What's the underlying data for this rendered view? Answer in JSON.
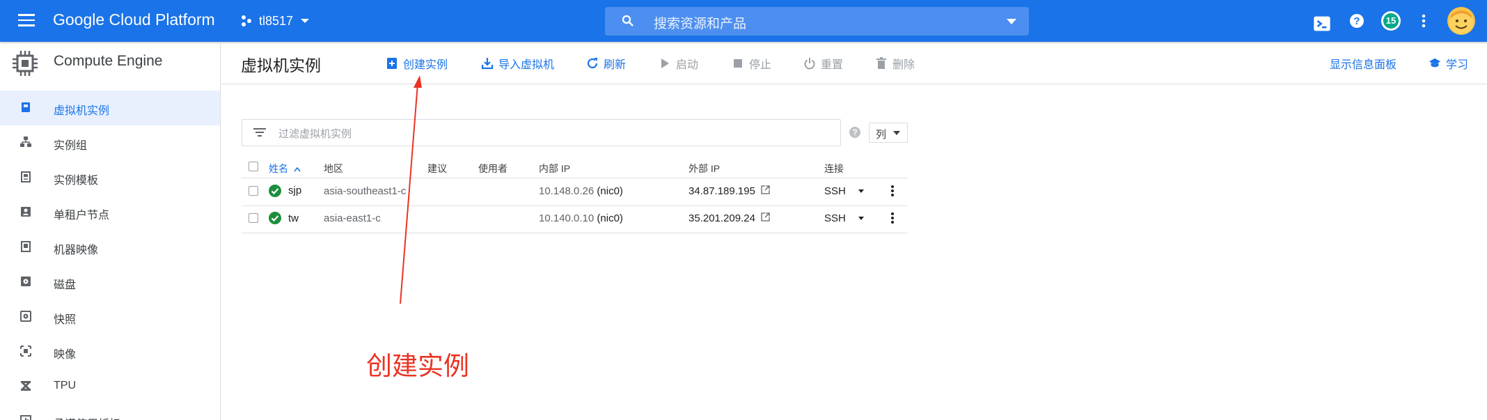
{
  "header": {
    "brand": "Google Cloud Platform",
    "project": "tl8517",
    "search_placeholder": "搜索资源和产品",
    "notifications": "15"
  },
  "sidebar": {
    "product": "Compute Engine",
    "items": [
      {
        "label": "虚拟机实例"
      },
      {
        "label": "实例组"
      },
      {
        "label": "实例模板"
      },
      {
        "label": "单租户节点"
      },
      {
        "label": "机器映像"
      },
      {
        "label": "磁盘"
      },
      {
        "label": "快照"
      },
      {
        "label": "映像"
      },
      {
        "label": "TPU"
      },
      {
        "label": "承诺使用折扣"
      }
    ]
  },
  "toolbar": {
    "title": "虚拟机实例",
    "create": "创建实例",
    "import": "导入虚拟机",
    "refresh": "刷新",
    "start": "启动",
    "stop": "停止",
    "reset": "重置",
    "delete": "删除",
    "info_panel": "显示信息面板",
    "learn": "学习"
  },
  "filter": {
    "placeholder": "过滤虚拟机实例",
    "columns": "列"
  },
  "table": {
    "headers": [
      "姓名",
      "地区",
      "建议",
      "使用者",
      "内部 IP",
      "外部 IP",
      "连接"
    ],
    "rows": [
      {
        "name": "sjp",
        "zone": "asia-southeast1-c",
        "internal_ip": "10.148.0.26",
        "nic": "(nic0)",
        "external_ip": "34.87.189.195",
        "connect": "SSH"
      },
      {
        "name": "tw",
        "zone": "asia-east1-c",
        "internal_ip": "10.140.0.10",
        "nic": "(nic0)",
        "external_ip": "35.201.209.24",
        "connect": "SSH"
      }
    ]
  },
  "annotation": {
    "text": "创建实例",
    "color": "#ea3323"
  },
  "colors": {
    "accent": "#1a73e8",
    "status_ok": "#1e8e3e"
  }
}
